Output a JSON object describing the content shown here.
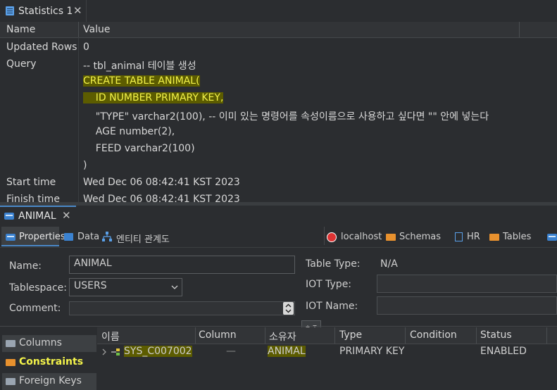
{
  "top_tab": {
    "label": "Statistics 1",
    "close": "✕"
  },
  "stats": {
    "columns": [
      "Name",
      "Value"
    ],
    "rows": {
      "updated_rows": {
        "name": "Updated Rows",
        "value": "0"
      },
      "query": {
        "name": "Query",
        "lines": [
          "-- tbl_animal 테이블 생성",
          "CREATE TABLE ANIMAL(",
          "    ID NUMBER PRIMARY KEY,",
          "    \"TYPE\" varchar2(100), -- 이미 있는 명령어를 속성이름으로 사용하고 싶다면 \"\" 안에 넣는다",
          "    AGE number(2),",
          "    FEED varchar2(100)",
          ")"
        ]
      },
      "start_time": {
        "name": "Start time",
        "value": "Wed Dec 06 08:42:41 KST 2023"
      },
      "finish_time": {
        "name": "Finish time",
        "value": "Wed Dec 06 08:42:41 KST 2023"
      }
    }
  },
  "editor_tab": {
    "label": "ANIMAL",
    "close": "✕"
  },
  "toolbar": {
    "properties": "Properties",
    "data": "Data",
    "er": "엔티티 관계도",
    "connection": "localhost",
    "schemas": "Schemas",
    "schema": "HR",
    "tables": "Tables"
  },
  "form": {
    "name_label": "Name:",
    "name_value": "ANIMAL",
    "tablespace_label": "Tablespace:",
    "tablespace_value": "USERS",
    "comment_label": "Comment:",
    "comment_value": "",
    "table_type_label": "Table Type:",
    "table_type_value": "N/A",
    "iot_type_label": "IOT Type:",
    "iot_type_value": "",
    "iot_name_label": "IOT Name:",
    "iot_name_value": ""
  },
  "side_tabs": [
    "Columns",
    "Constraints",
    "Foreign Keys"
  ],
  "constraints": {
    "columns": [
      "이름",
      "Column",
      "소유자",
      "Type",
      "Condition",
      "Status"
    ],
    "rows": [
      {
        "name": "SYS_C007002",
        "column": "—",
        "owner": "ANIMAL",
        "type": "PRIMARY KEY",
        "condition": "",
        "status": "ENABLED"
      }
    ]
  },
  "colors": {
    "accent": "#4a88c7",
    "highlight": "#f3f34a",
    "highlight_bg": "#5c5c00"
  }
}
